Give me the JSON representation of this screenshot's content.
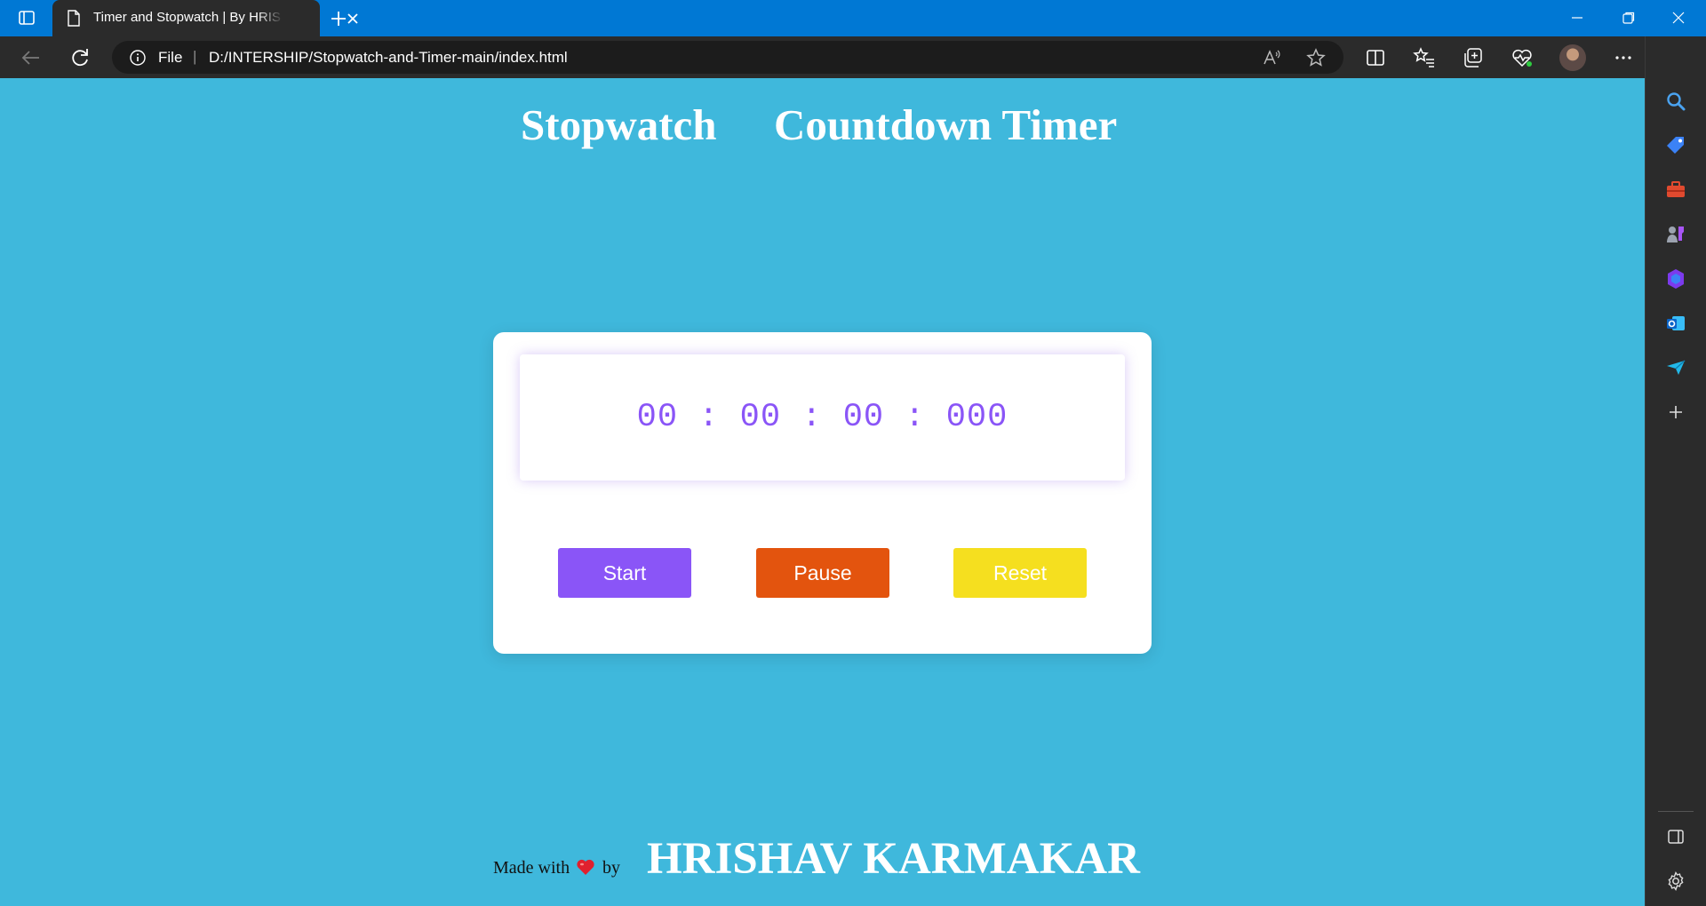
{
  "browser": {
    "tab_title": "Timer and Stopwatch | By HRISHAV KARMAKAR",
    "address_scheme": "File",
    "url": "D:/INTERSHIP/Stopwatch-and-Timer-main/index.html"
  },
  "nav": {
    "stopwatch": "Stopwatch",
    "countdown": "Countdown Timer"
  },
  "stopwatch": {
    "time": "00 : 00 : 00 : 000",
    "start_label": "Start",
    "pause_label": "Pause",
    "reset_label": "Reset"
  },
  "footer": {
    "made_with": "Made with",
    "by": "by",
    "author": "HRISHAV KARMAKAR"
  },
  "colors": {
    "page_background": "#3fb8dc",
    "time_text": "#8a55f7",
    "start_button": "#8a55f7",
    "pause_button": "#e3540e",
    "reset_button": "#f5df1f",
    "heart": "#e0202e"
  },
  "icons": [
    "tab-actions-icon",
    "document-icon",
    "close-icon",
    "plus-icon",
    "minimize-icon",
    "restore-icon",
    "back-arrow-icon",
    "refresh-icon",
    "info-icon",
    "read-aloud-icon",
    "star-icon",
    "split-screen-icon",
    "favorites-icon",
    "collections-icon",
    "browser-essentials-icon",
    "more-icon",
    "bing-copilot-icon",
    "search-icon",
    "shopping-tag-icon",
    "tools-icon",
    "games-icon",
    "office-icon",
    "outlook-icon",
    "send-icon",
    "add-icon",
    "sidebar-toggle-icon",
    "settings-icon",
    "heart-icon"
  ]
}
